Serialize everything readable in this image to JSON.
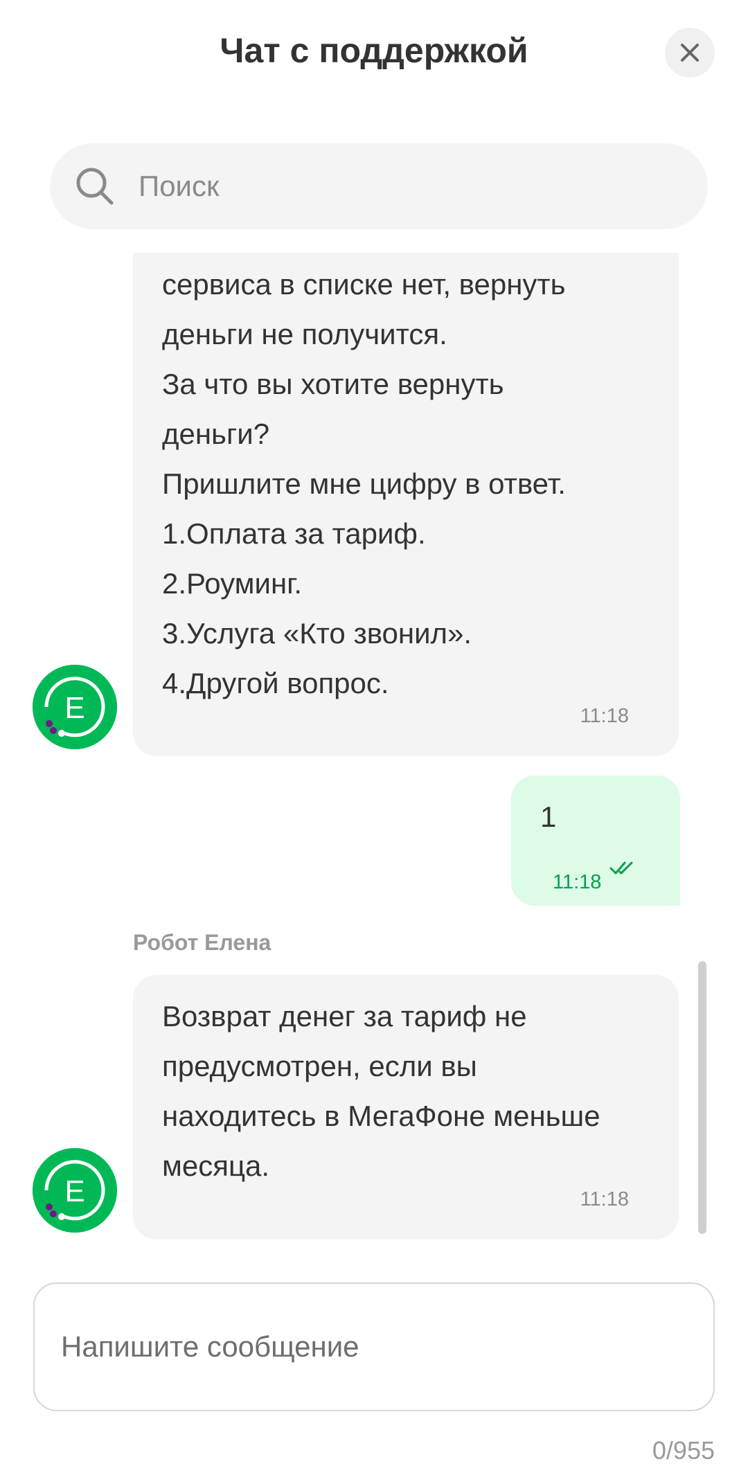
{
  "header": {
    "title": "Чат с поддержкой"
  },
  "search": {
    "placeholder": "Поиск"
  },
  "messages": [
    {
      "lines": [
        "сервиса в списке нет, вернуть",
        "деньги не получится.",
        "За что вы хотите вернуть",
        "деньги?",
        "Пришлите мне цифру в ответ.",
        "1.Оплата за тариф.",
        "2.Роуминг.",
        "3.Услуга «Кто звонил».",
        "4.Другой вопрос."
      ],
      "time": "11:18"
    },
    {
      "text": "1",
      "time": "11:18"
    },
    {
      "sender": "Робот Елена",
      "lines": [
        "Возврат денег за тариф не",
        "предусмотрен, если вы",
        "находитесь в МегаФоне меньше",
        "месяца."
      ],
      "time": "11:18"
    }
  ],
  "avatar": {
    "letter": "E"
  },
  "composer": {
    "placeholder": "Напишите сообщение",
    "counter": "0/955"
  },
  "colors": {
    "brand_green": "#00b956",
    "user_bubble": "#ddfbe7",
    "bot_bubble": "#f4f4f4",
    "accent_purple": "#731982"
  }
}
